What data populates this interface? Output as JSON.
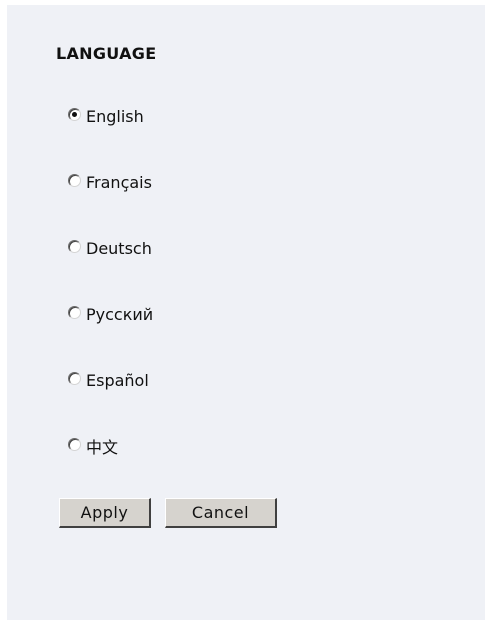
{
  "section": {
    "title": "LANGUAGE"
  },
  "languages": [
    {
      "label": "English",
      "checked": true
    },
    {
      "label": "Français",
      "checked": false
    },
    {
      "label": "Deutsch",
      "checked": false
    },
    {
      "label": "Русский",
      "checked": false
    },
    {
      "label": "Español",
      "checked": false
    },
    {
      "label": "中文",
      "checked": false
    }
  ],
  "buttons": {
    "apply_label": "Apply",
    "cancel_label": "Cancel"
  }
}
